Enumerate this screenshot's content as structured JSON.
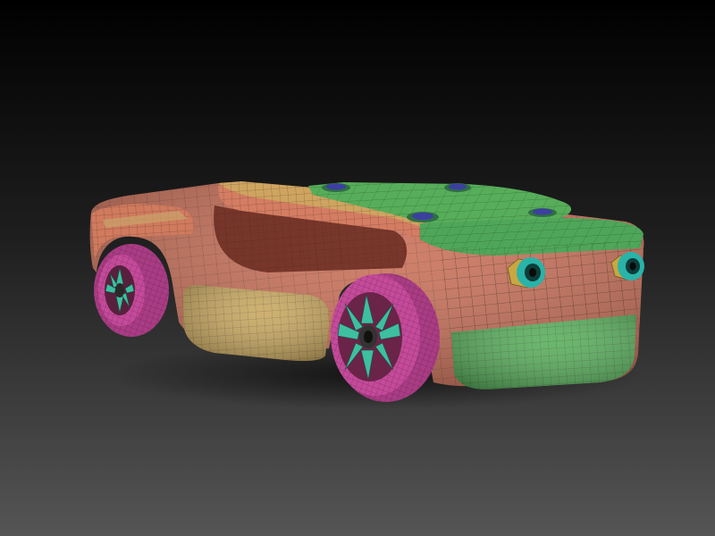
{
  "scene": {
    "subject": "polygroup-colored-car-mesh",
    "show_wireframe": true,
    "polygroup_colors": {
      "body": "#c86e56",
      "roof": "#57ad5a",
      "sill": "#c8a75e",
      "wheel_tire": "#c44a9a",
      "wheel_spokes": "#3dbfa0",
      "bolt_caps": "#3c3fa0",
      "exhaust_ring": "#2ab3a8",
      "exhaust_nut": "#c9a742"
    },
    "background": {
      "top": "#000000",
      "bottom": "#555555"
    }
  }
}
